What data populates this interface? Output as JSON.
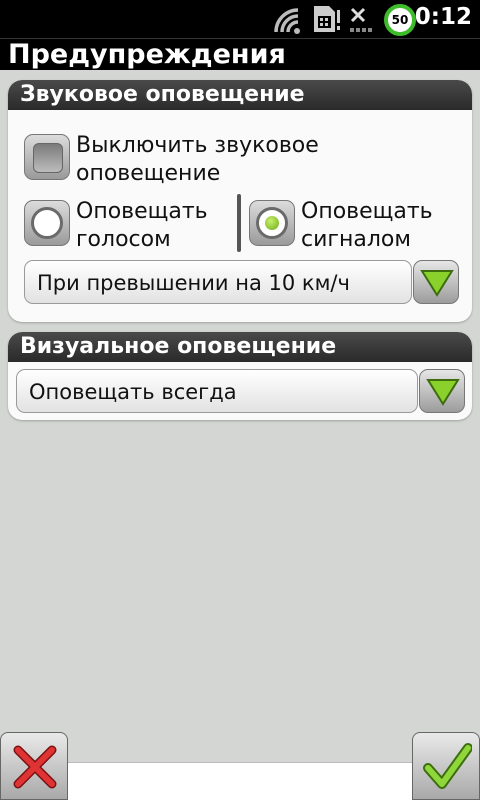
{
  "status": {
    "time": "0:12",
    "battery": "50"
  },
  "title": "Предупреждения",
  "sound_panel": {
    "header": "Звуковое оповещение",
    "disable_label_line1": "Выключить звуковое",
    "disable_label_line2": "оповещение",
    "voice_label_line1": "Оповещать",
    "voice_label_line2": "голосом",
    "signal_label_line1": "Оповещать",
    "signal_label_line2": "сигналом",
    "dropdown_value": "При превышении на 10 км/ч"
  },
  "visual_panel": {
    "header": "Визуальное оповещение",
    "dropdown_value": "Оповещать всегда"
  },
  "colors": {
    "accent_green": "#7cc11e",
    "cancel_red": "#d62a2a",
    "panel_header": "#333333"
  },
  "icons": [
    "wifi-icon",
    "sim-icon",
    "signal-off-icon",
    "battery-icon",
    "dropdown-arrow-icon",
    "cancel-icon",
    "confirm-icon"
  ]
}
